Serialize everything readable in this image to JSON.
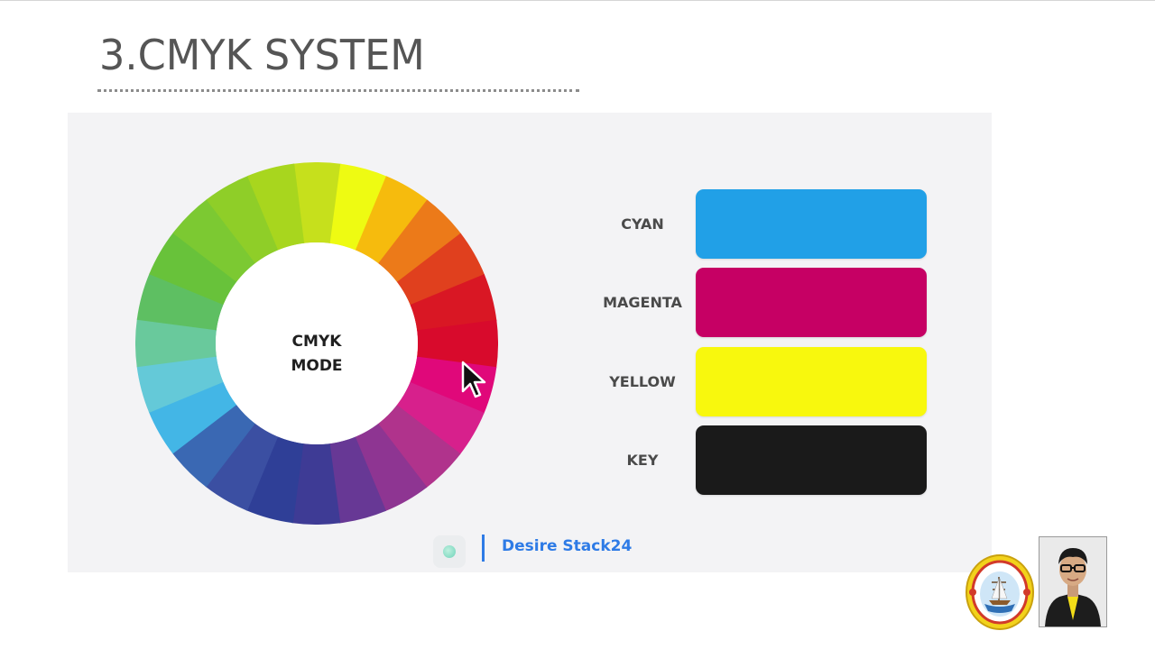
{
  "slide": {
    "title": "3.CMYK SYSTEM"
  },
  "wheel": {
    "center_label_line1": "CMYK",
    "center_label_line2": "MODE",
    "segment_colors": [
      "#c6e01c",
      "#eefb12",
      "#f6bb0d",
      "#ec7a19",
      "#e0401e",
      "#d91724",
      "#d80a2c",
      "#e0087a",
      "#d7208c",
      "#b0338c",
      "#8e3592",
      "#673895",
      "#3e3b95",
      "#2f3f97",
      "#3b4fa2",
      "#3a68b3",
      "#43b6e6",
      "#64c9d8",
      "#69c99c",
      "#5ebf62",
      "#68c23a",
      "#7cc932",
      "#8fce28",
      "#a8d61e"
    ]
  },
  "swatches": [
    {
      "name": "CYAN",
      "color": "#21a0e7"
    },
    {
      "name": "MAGENTA",
      "color": "#c60064"
    },
    {
      "name": "YELLOW",
      "color": "#f8f80d"
    },
    {
      "name": "KEY",
      "color": "#1a1a1a"
    }
  ],
  "footer": {
    "brand": "Desire Stack24"
  }
}
